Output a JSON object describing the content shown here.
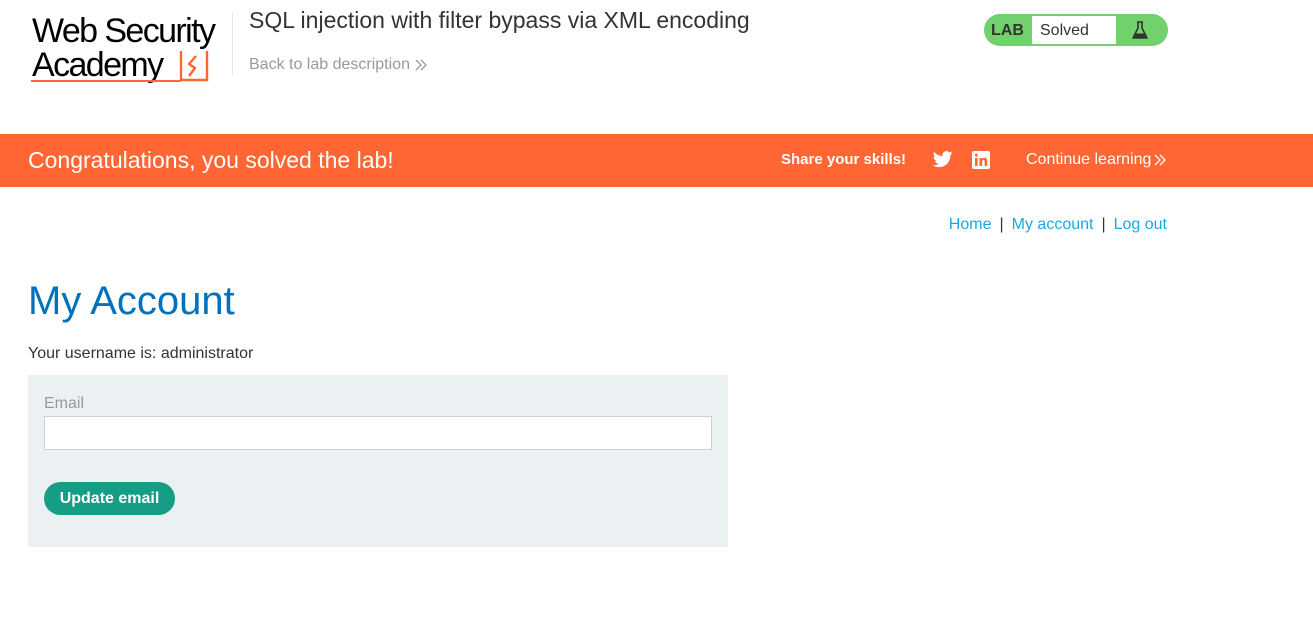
{
  "header": {
    "logo": {
      "line1": "Web Security",
      "line2": "Academy"
    },
    "lab_title": "SQL injection with filter bypass via XML encoding",
    "back_link": "Back to lab description",
    "lab_badge": {
      "label": "LAB",
      "status": "Solved",
      "icon": "flask-icon",
      "color": "#70d16d"
    }
  },
  "banner": {
    "message": "Congratulations, you solved the lab!",
    "share_label": "Share your skills!",
    "icons": [
      "twitter-icon",
      "linkedin-icon"
    ],
    "continue_link": "Continue learning",
    "color": "#ff6633"
  },
  "nav": {
    "home": "Home",
    "separator": "|",
    "my_account": "My account",
    "log_out": "Log out"
  },
  "main": {
    "title": "My Account",
    "username_text": "Your username is: administrator",
    "form": {
      "email_label": "Email",
      "email_value": "",
      "submit_label": "Update email",
      "button_color": "#159d85"
    }
  }
}
